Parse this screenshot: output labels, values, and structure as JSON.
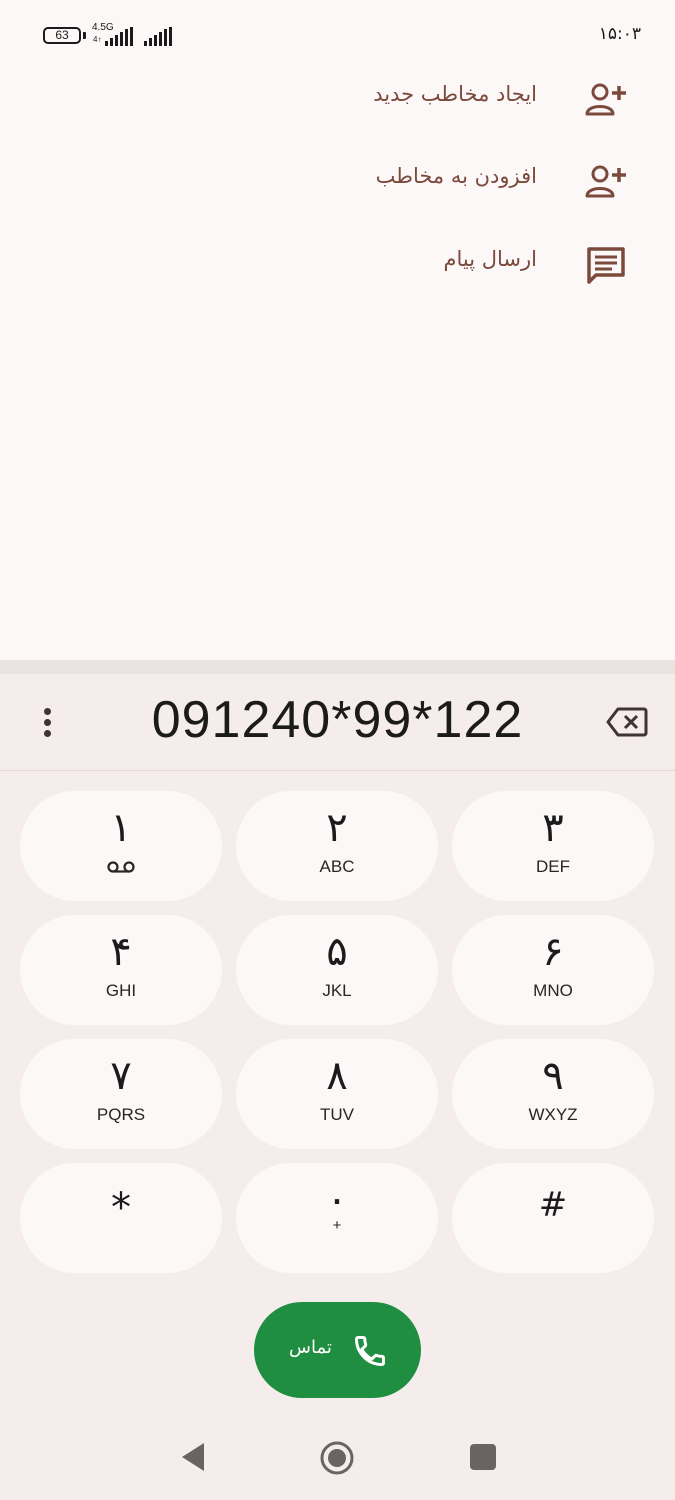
{
  "status_bar": {
    "battery_level": "63",
    "network_type": "4.5G",
    "network_arrows": "4↑",
    "clock": "۱۵:۰۳"
  },
  "actions": [
    {
      "label": "ایجاد مخاطب جدید",
      "icon": "add-contact-icon"
    },
    {
      "label": "افزودن به مخاطب",
      "icon": "add-contact-icon"
    },
    {
      "label": "ارسال پیام",
      "icon": "message-icon"
    }
  ],
  "dialer": {
    "number": "091240*99*122",
    "keys": [
      {
        "digit": "۱",
        "letters": "",
        "voicemail": true
      },
      {
        "digit": "۲",
        "letters": "ABC"
      },
      {
        "digit": "۳",
        "letters": "DEF"
      },
      {
        "digit": "۴",
        "letters": "GHI"
      },
      {
        "digit": "۵",
        "letters": "JKL"
      },
      {
        "digit": "۶",
        "letters": "MNO"
      },
      {
        "digit": "۷",
        "letters": "PQRS"
      },
      {
        "digit": "۸",
        "letters": "TUV"
      },
      {
        "digit": "۹",
        "letters": "WXYZ"
      },
      {
        "digit": "*",
        "letters": ""
      },
      {
        "digit": "۰",
        "letters": "+"
      },
      {
        "digit": "#",
        "letters": ""
      }
    ],
    "call_label": "تماس"
  },
  "colors": {
    "accent_brown": "#7b4a3c",
    "call_green": "#1f8e41",
    "panel_bg": "#f5edeb"
  }
}
